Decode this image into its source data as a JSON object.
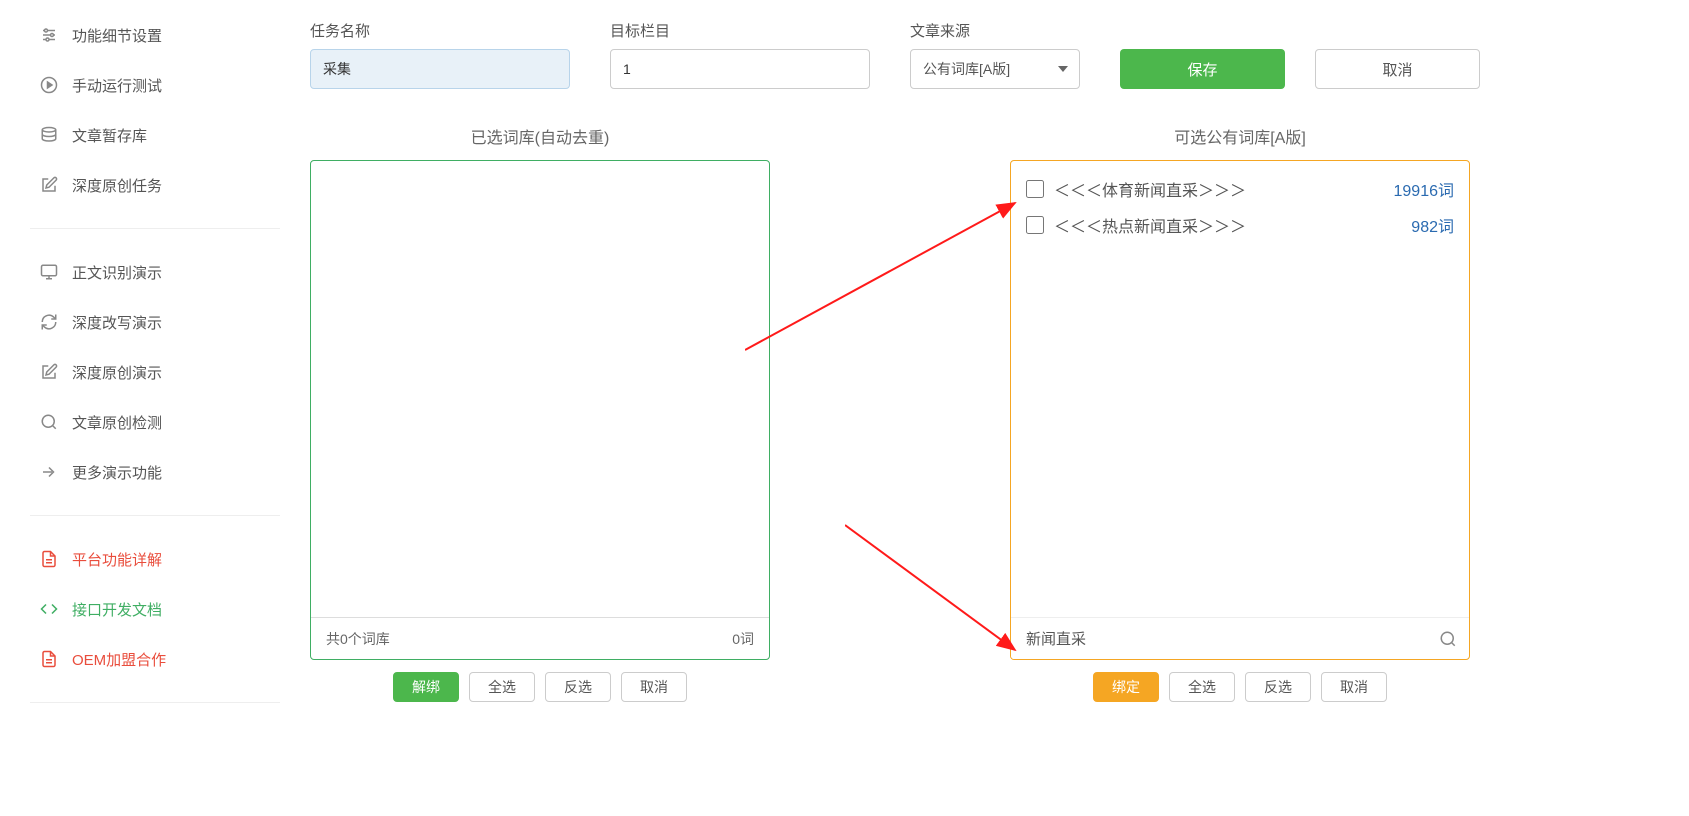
{
  "sidebar": {
    "group1": [
      {
        "icon": "sliders",
        "label": "功能细节设置"
      },
      {
        "icon": "play",
        "label": "手动运行测试"
      },
      {
        "icon": "db",
        "label": "文章暂存库"
      },
      {
        "icon": "edit",
        "label": "深度原创任务"
      }
    ],
    "group2": [
      {
        "icon": "monitor",
        "label": "正文识别演示"
      },
      {
        "icon": "refresh",
        "label": "深度改写演示"
      },
      {
        "icon": "edit",
        "label": "深度原创演示"
      },
      {
        "icon": "search",
        "label": "文章原创检测"
      },
      {
        "icon": "share",
        "label": "更多演示功能"
      }
    ],
    "group3": [
      {
        "icon": "doc",
        "label": "平台功能详解",
        "color": "red"
      },
      {
        "icon": "code",
        "label": "接口开发文档",
        "color": "green"
      },
      {
        "icon": "doc",
        "label": "OEM加盟合作",
        "color": "red"
      }
    ]
  },
  "form": {
    "task_name_label": "任务名称",
    "task_name_value": "采集",
    "target_col_label": "目标栏目",
    "target_col_value": "1",
    "source_label": "文章来源",
    "source_value": "公有词库[A版]",
    "save_label": "保存",
    "cancel_label": "取消"
  },
  "panels": {
    "left_title": "已选词库(自动去重)",
    "left_footer_left": "共0个词库",
    "left_footer_right": "0词",
    "right_title": "可选公有词库[A版]",
    "right_items": [
      {
        "name": "＜＜＜体育新闻直采＞＞＞",
        "count": "19916词"
      },
      {
        "name": "＜＜＜热点新闻直采＞＞＞",
        "count": "982词"
      }
    ],
    "right_search_value": "新闻直采"
  },
  "actions": {
    "unbind": "解绑",
    "select_all": "全选",
    "invert": "反选",
    "cancel": "取消",
    "bind": "绑定"
  }
}
